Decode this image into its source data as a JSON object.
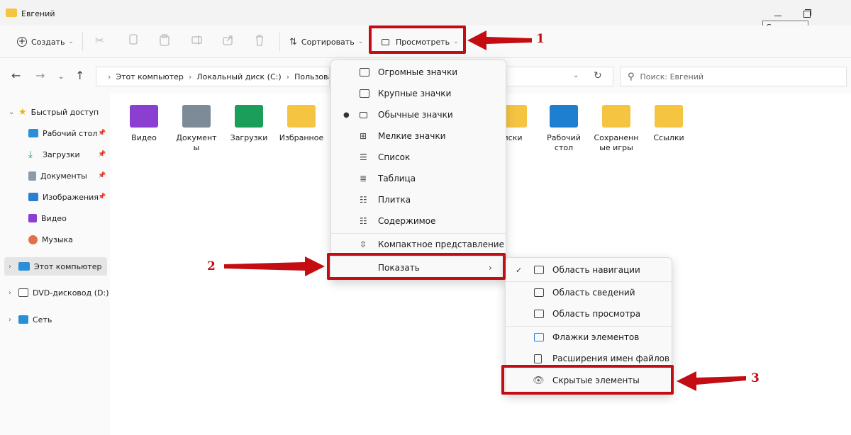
{
  "window": {
    "title": "Евгений",
    "tooltip": "Свернуть",
    "minimize_icon": "minimize-icon",
    "maximize_icon": "restore-icon"
  },
  "toolbar": {
    "create_label": "Создать",
    "sort_label": "Сортировать",
    "view_label": "Просмотреть"
  },
  "address": {
    "crumbs": [
      "Этот компьютер",
      "Локальный диск (C:)",
      "Пользоват"
    ],
    "search_placeholder": "Поиск: Евгений"
  },
  "sidebar": {
    "items": [
      {
        "label": "Быстрый доступ",
        "icon": "star-icon",
        "color": "#f0b400"
      },
      {
        "label": "Рабочий стол",
        "icon": "desktop-icon",
        "color": "#2a8fd8"
      },
      {
        "label": "Загрузки",
        "icon": "download-icon",
        "color": "#1a9e5a"
      },
      {
        "label": "Документы",
        "icon": "document-icon",
        "color": "#8d9aa8"
      },
      {
        "label": "Изображения",
        "icon": "image-icon",
        "color": "#2a7fd4"
      },
      {
        "label": "Видео",
        "icon": "video-icon",
        "color": "#8a3fd1"
      },
      {
        "label": "Музыка",
        "icon": "music-icon",
        "color": "#e0704a"
      },
      {
        "label": "Этот компьютер",
        "icon": "computer-icon",
        "color": "#2a8fd8"
      },
      {
        "label": "DVD-дисковод (D:)",
        "icon": "dvd-icon",
        "color": "#555555"
      },
      {
        "label": "Сеть",
        "icon": "network-icon",
        "color": "#2a8fd8"
      }
    ]
  },
  "folders": [
    {
      "label": "Видео",
      "color": "#8a3fd1"
    },
    {
      "label": "Документ\nы",
      "color": "#7d8b99"
    },
    {
      "label": "Загрузки",
      "color": "#1a9e5a"
    },
    {
      "label": "Избранное",
      "color": "#f5c542"
    },
    {
      "label": "иски",
      "color": "#f5c542"
    },
    {
      "label": "Рабочий\nстол",
      "color": "#1e7fd0"
    },
    {
      "label": "Сохраненн\nые игры",
      "color": "#f5c542"
    },
    {
      "label": "Ссылки",
      "color": "#f5c542"
    }
  ],
  "view_menu": {
    "items": [
      {
        "label": "Огромные значки",
        "icon": "large-icons-icon"
      },
      {
        "label": "Крупные значки",
        "icon": "large-icons-icon"
      },
      {
        "label": "Обычные значки",
        "icon": "medium-icons-icon",
        "selected": true
      },
      {
        "label": "Мелкие значки",
        "icon": "small-icons-icon"
      },
      {
        "label": "Список",
        "icon": "list-icon"
      },
      {
        "label": "Таблица",
        "icon": "details-icon"
      },
      {
        "label": "Плитка",
        "icon": "tiles-icon"
      },
      {
        "label": "Содержимое",
        "icon": "content-icon"
      },
      {
        "label": "Компактное представление",
        "icon": "compact-icon"
      },
      {
        "label": "Показать",
        "icon": "",
        "has_submenu": true
      }
    ]
  },
  "show_menu": {
    "items": [
      {
        "label": "Область навигации",
        "checked": true
      },
      {
        "label": "Область сведений"
      },
      {
        "label": "Область просмотра"
      },
      {
        "label": "Флажки элементов"
      },
      {
        "label": "Расширения имен файлов"
      },
      {
        "label": "Скрытые элементы"
      }
    ]
  },
  "annotations": {
    "n1": "1",
    "n2": "2",
    "n3": "3",
    "color": "#c40d12"
  }
}
